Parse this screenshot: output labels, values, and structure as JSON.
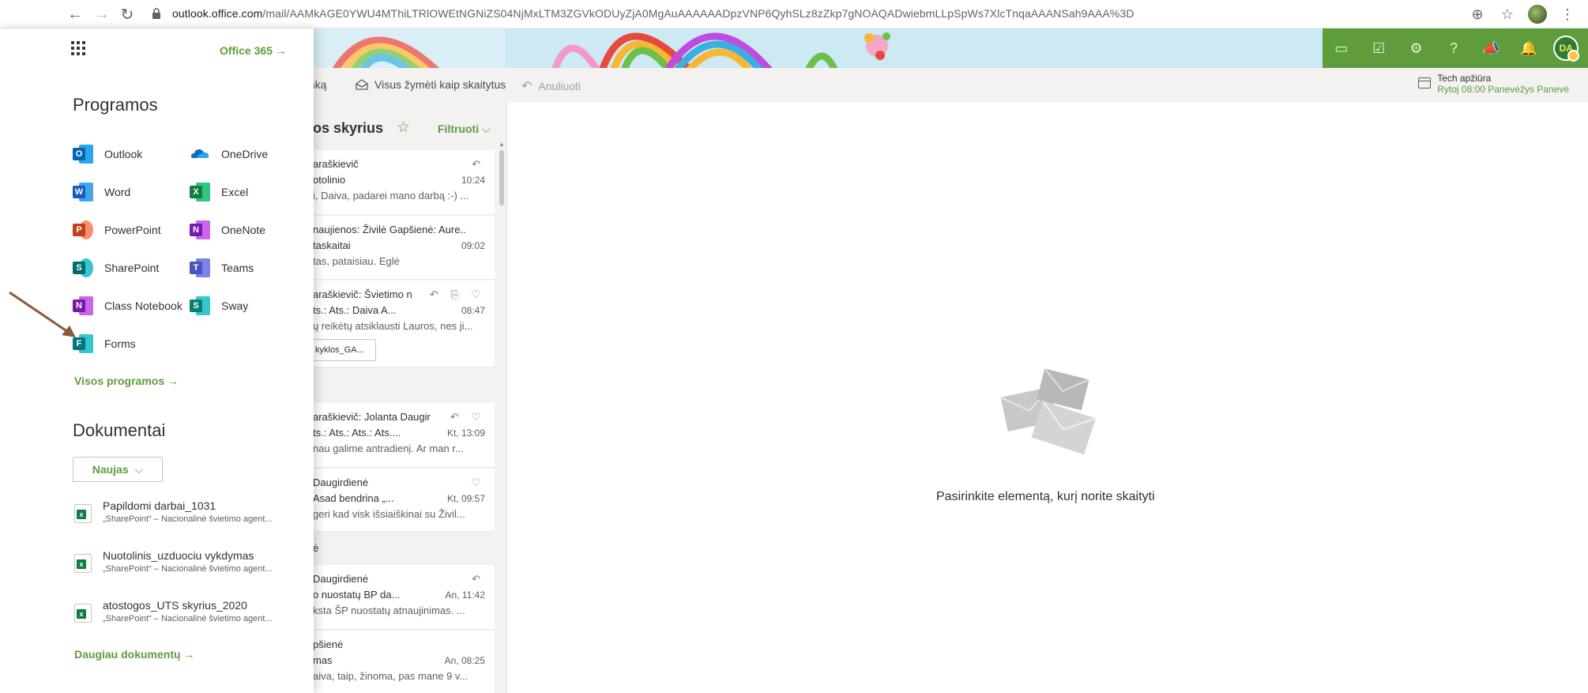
{
  "browser": {
    "url_host": "outlook.office.com",
    "url_path": "/mail/AAMkAGE0YWU4MThiLTRlOWEtNGNiZS04NjMxLTM3ZGVkODUyZjA0MgAuAAAAAADpzVNP6QyhSLz8zZkp7gNOAQADwiebmLLpSpWs7XlcTnqaAAANSah9AAA%3D"
  },
  "launcher": {
    "office365_label": "Office 365",
    "apps_title": "Programos",
    "apps": [
      {
        "name": "Outlook",
        "letter": "O"
      },
      {
        "name": "OneDrive",
        "letter": ""
      },
      {
        "name": "Word",
        "letter": "W"
      },
      {
        "name": "Excel",
        "letter": "X"
      },
      {
        "name": "PowerPoint",
        "letter": "P"
      },
      {
        "name": "OneNote",
        "letter": "N"
      },
      {
        "name": "SharePoint",
        "letter": "S"
      },
      {
        "name": "Teams",
        "letter": "T"
      },
      {
        "name": "Class Notebook",
        "letter": "N"
      },
      {
        "name": "Sway",
        "letter": "S"
      },
      {
        "name": "Forms",
        "letter": "F"
      }
    ],
    "all_apps_label": "Visos programos",
    "docs_title": "Dokumentai",
    "new_label": "Naujas",
    "documents": [
      {
        "name": "Papildomi darbai_1031",
        "location": "„SharePoint“ – Nacionalinė švietimo agent..."
      },
      {
        "name": "Nuotolinis_uzduociu vykdymas",
        "location": "„SharePoint“ – Nacionalinė švietimo agent..."
      },
      {
        "name": "atostogos_UTS skyrius_2020",
        "location": "„SharePoint“ – Nacionalinė švietimo agent..."
      }
    ],
    "more_docs_label": "Daugiau dokumentų"
  },
  "commandbar": {
    "folder_action": "lanką",
    "mark_all_read": "Visus žymėti kaip skaitytus",
    "undo": "Anuliuoti"
  },
  "reminder": {
    "title": "Tech apžiūra",
    "detail": "Rytoj 08:00 Panevėžys Panevė"
  },
  "folder": {
    "title": "idos skyrius",
    "filter_label": "Filtruoti"
  },
  "messages": [
    {
      "from": "araškievič",
      "subject": "otolinio",
      "time": "10:24",
      "preview": "i, Daiva, padarei mano darbą :-) ..."
    },
    {
      "from": "naujienos: Živilė Gapšienė: Aure..",
      "subject": "taskaitai",
      "time": "09:02",
      "preview": "tas, pataisiau. Eglė"
    },
    {
      "from": "araškievič: Švietimo n",
      "subject": "ts.: Ats.: Daiva A...",
      "time": "08:47",
      "preview": "ų reikėtų atsiklausti Lauros, nes ji...",
      "attachment": "kyklos_GA..."
    },
    {
      "from": "araškievič: Jolanta Daugir",
      "subject": "ts.: Ats.: Ats.: Ats....",
      "time": "Kt, 13:09",
      "preview": "nau galime antradienį. Ar man r..."
    },
    {
      "from": "Daugirdienė",
      "subject": "Asad bendrina „...",
      "time": "Kt, 09:57",
      "preview": "geri kad visk išsiaiškinai su Živil..."
    },
    {
      "from": "Daugirdienė",
      "subject": "o nuostatų BP da...",
      "time": "An, 11:42",
      "preview": "ksta ŠP nuostatų atnaujinimas. ..."
    },
    {
      "from": "pšienė",
      "subject": "mas",
      "time": "An, 08:25",
      "preview": "aiva, taip, žinoma, pas mane 9 v..."
    }
  ],
  "group_label_2": "ė",
  "reading_pane": {
    "empty_text": "Pasirinkite elementą, kurį norite skaityti"
  },
  "user": {
    "initials": "DA"
  }
}
